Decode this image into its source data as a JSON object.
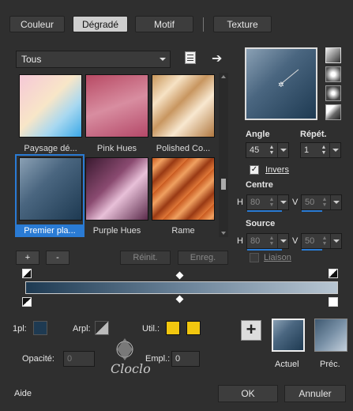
{
  "tabs": [
    {
      "label": "Couleur",
      "active": false
    },
    {
      "label": "Dégradé",
      "active": true
    },
    {
      "label": "Motif",
      "active": false
    },
    {
      "label": "Texture",
      "active": false
    }
  ],
  "category": {
    "selected": "Tous"
  },
  "gradients": [
    {
      "label": "Paysage dé...",
      "selected": false
    },
    {
      "label": "Pink Hues",
      "selected": false
    },
    {
      "label": "Polished Co...",
      "selected": false
    },
    {
      "label": "Premier pla...",
      "selected": true
    },
    {
      "label": "Purple Hues",
      "selected": false
    },
    {
      "label": "Rame",
      "selected": false
    }
  ],
  "list_buttons": {
    "add": "+",
    "remove": "-",
    "reset": "Réinit.",
    "save": "Enreg."
  },
  "settings": {
    "angle_label": "Angle",
    "angle_value": "45",
    "repeat_label": "Répét.",
    "repeat_value": "1",
    "invert_label": "Invers",
    "invert_checked": true,
    "center_label": "Centre",
    "center_h_label": "H",
    "center_h": "80",
    "center_v_label": "V",
    "center_v": "50",
    "source_label": "Source",
    "source_h_label": "H",
    "source_h": "80",
    "source_v_label": "V",
    "source_v": "50",
    "link_label": "Liaison",
    "link_checked": false
  },
  "stops": {
    "first_label": "1pl:",
    "first_color": "#1e3a52",
    "bg_label": "Arpl:",
    "use_label": "Util.:",
    "use_color": "#f2c70f",
    "opacity_label": "Opacité:",
    "opacity_value": "0",
    "location_label": "Empl.:",
    "location_value": "0"
  },
  "preview": {
    "current_label": "Actuel",
    "previous_label": "Préc."
  },
  "footer": {
    "help": "Aide",
    "ok": "OK",
    "cancel": "Annuler"
  },
  "icons": {
    "dropdown_caret": "chevron-down-icon",
    "arrow": "arrow-right-icon",
    "add": "plus-icon"
  }
}
